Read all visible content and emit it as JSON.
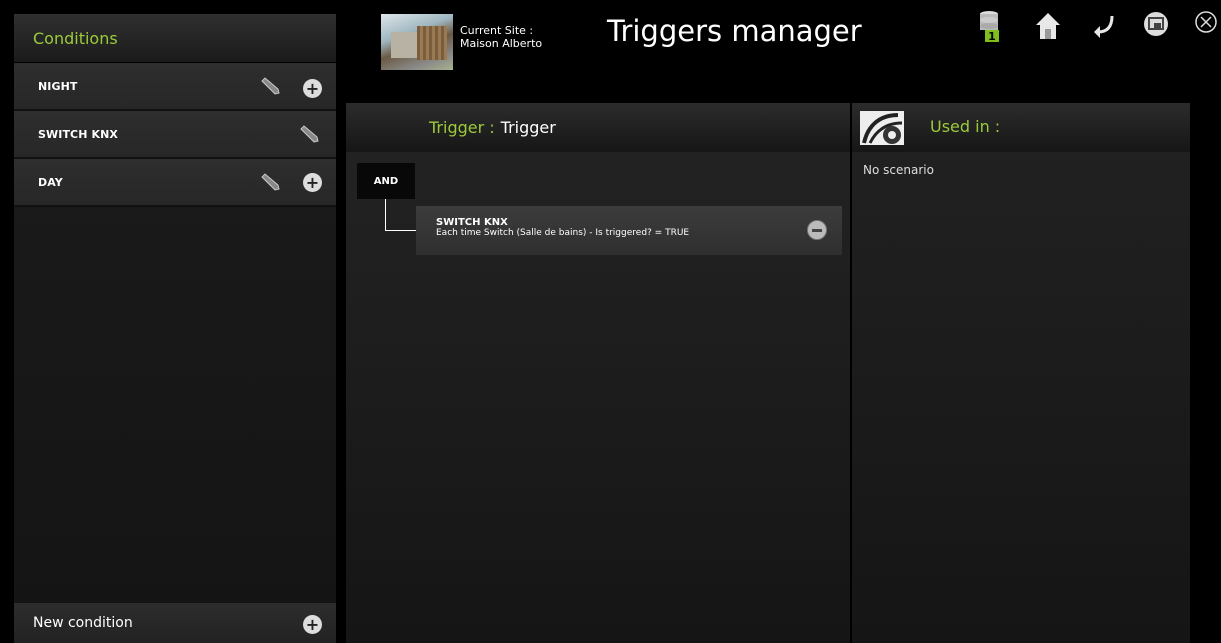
{
  "conditions": {
    "title": "Conditions",
    "items": [
      {
        "label": "NIGHT"
      },
      {
        "label": "SWITCH KNX"
      },
      {
        "label": "DAY"
      }
    ],
    "new_label": "New condition"
  },
  "header": {
    "site_caption": "Current Site :",
    "site_name": "Maison Alberto",
    "title": "Triggers manager",
    "badge": "1",
    "icons": [
      "database-icon",
      "home-icon",
      "back-icon",
      "screen-icon",
      "close-icon"
    ]
  },
  "trigger": {
    "prefix": "Trigger : ",
    "name": "Trigger",
    "operator": "AND",
    "rule_title": "SWITCH KNX",
    "rule_desc": "Each time Switch (Salle de bains) - Is triggered? = TRUE"
  },
  "used_in": {
    "title": "Used in :",
    "empty": "No scenario"
  },
  "colors": {
    "accent": "#9ccb3a",
    "badge": "#7cbf1f"
  }
}
